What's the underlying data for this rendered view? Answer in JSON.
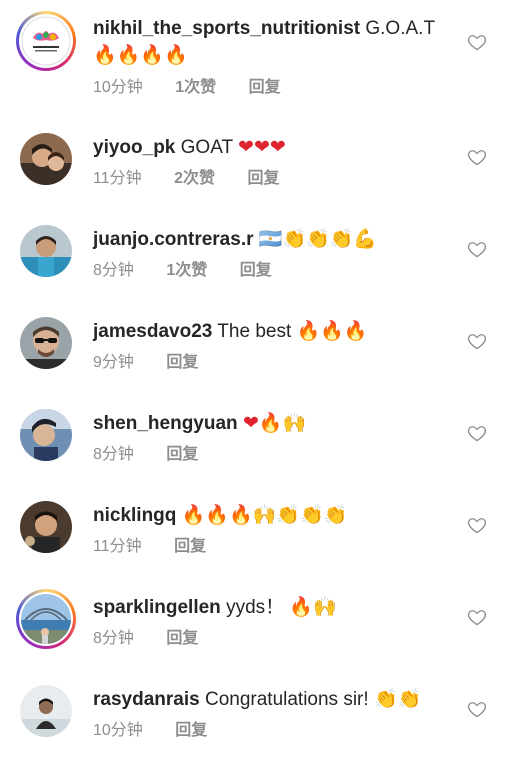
{
  "comments": [
    {
      "username": "nikhil_the_sports_nutritionist",
      "text": "G.O.A.T",
      "emoji": "🔥🔥🔥🔥",
      "time": "10分钟",
      "likes": "1次赞",
      "reply": "回复",
      "avatar": "logo-ring"
    },
    {
      "username": "yiyoo_pk",
      "text": "GOAT",
      "emoji": "❤❤❤",
      "time": "11分钟",
      "likes": "2次赞",
      "reply": "回复",
      "avatar": "photo"
    },
    {
      "username": "juanjo.contreras.r",
      "text": "",
      "emoji": "🇦🇷👏👏👏💪",
      "time": "8分钟",
      "likes": "1次赞",
      "reply": "回复",
      "avatar": "photo"
    },
    {
      "username": "jamesdavo23",
      "text": "The best",
      "emoji": "🔥🔥🔥",
      "time": "9分钟",
      "likes": "",
      "reply": "回复",
      "avatar": "photo"
    },
    {
      "username": "shen_hengyuan",
      "text": "",
      "emoji": "❤🔥🙌",
      "time": "8分钟",
      "likes": "",
      "reply": "回复",
      "avatar": "photo"
    },
    {
      "username": "nicklingq",
      "text": "",
      "emoji": "🔥🔥🔥🙌👏👏👏",
      "time": "11分钟",
      "likes": "",
      "reply": "回复",
      "avatar": "photo"
    },
    {
      "username": "sparklingellen",
      "text": "yyds！",
      "emoji": "🔥🙌",
      "time": "8分钟",
      "likes": "",
      "reply": "回复",
      "avatar": "story-ring"
    },
    {
      "username": "rasydanrais",
      "text": "Congratulations sir!",
      "emoji": "👏👏",
      "time": "10分钟",
      "likes": "",
      "reply": "回复",
      "avatar": "photo"
    }
  ],
  "icons": {
    "like": "heart-outline-icon"
  },
  "colors": {
    "text": "#262626",
    "meta": "#8e8e8e",
    "fire": "#f57c00",
    "heart_red": "#e0242f"
  }
}
